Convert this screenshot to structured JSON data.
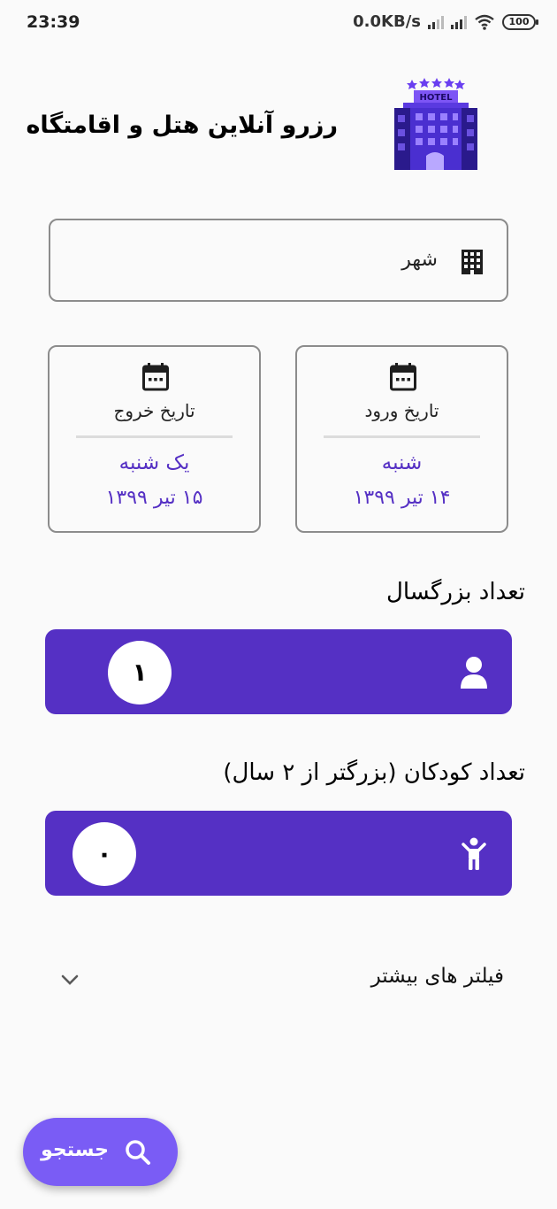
{
  "status_bar": {
    "time": "23:39",
    "network_speed": "0.0KB/s",
    "battery": "100"
  },
  "header": {
    "title": "رزرو آنلاین هتل و اقامتگاه",
    "logo_text": "HOTEL",
    "logo_icon": "hotel-building-icon"
  },
  "city_field": {
    "label": "شهر",
    "icon": "city-building-icon"
  },
  "checkin": {
    "label": "تاریخ ورود",
    "day": "شنبه",
    "date": "۱۴ تیر ۱۳۹۹",
    "icon": "calendar-icon"
  },
  "checkout": {
    "label": "تاریخ خروج",
    "day": "یک شنبه",
    "date": "۱۵ تیر ۱۳۹۹",
    "icon": "calendar-icon"
  },
  "adults": {
    "label": "تعداد بزرگسال",
    "count": "۱",
    "icon": "person-icon"
  },
  "children": {
    "label": "تعداد کودکان (بزرگتر از ۲ سال)",
    "count": "۰",
    "icon": "child-icon"
  },
  "filters": {
    "label": "فیلتر های بیشتر",
    "icon": "chevron-down-icon"
  },
  "search_button": {
    "label": "جستجو",
    "icon": "search-icon"
  },
  "colors": {
    "primary": "#5530c4",
    "fab": "#7a5cf5",
    "background": "#fafafa"
  }
}
